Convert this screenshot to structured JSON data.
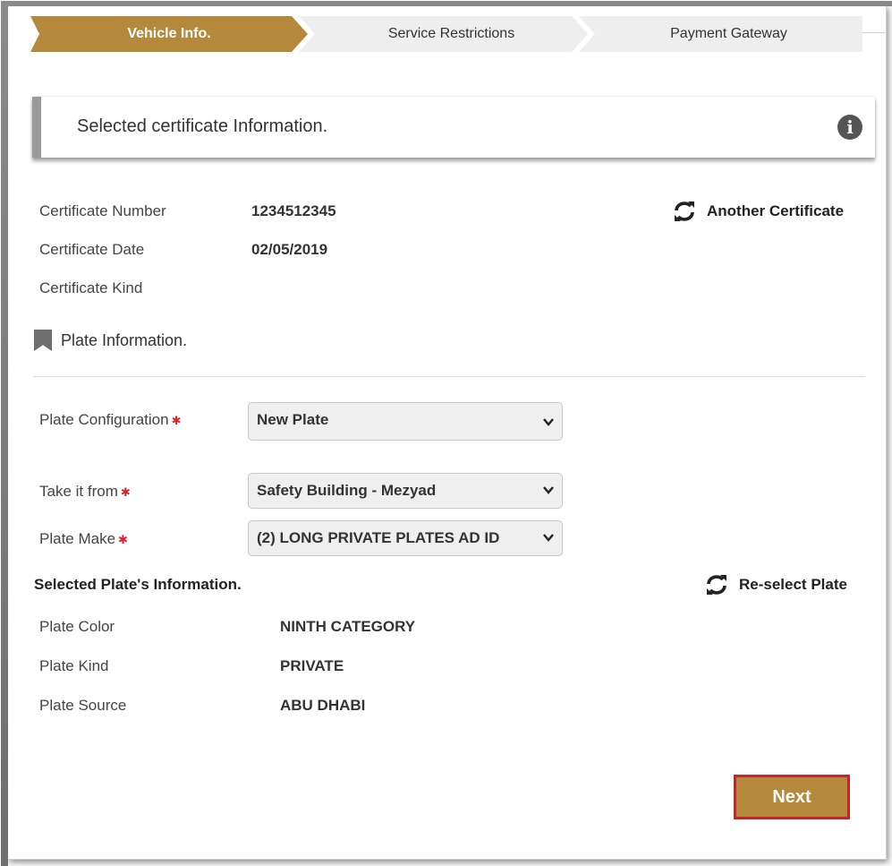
{
  "steps": [
    {
      "label": "Vehicle Info."
    },
    {
      "label": "Service Restrictions"
    },
    {
      "label": "Payment Gateway"
    }
  ],
  "info_banner": {
    "text": "Selected certificate Information.",
    "icon": "info-icon"
  },
  "certificate": {
    "number_label": "Certificate Number",
    "number_value": "1234512345",
    "date_label": "Certificate Date",
    "date_value": "02/05/2019",
    "kind_label": "Certificate Kind",
    "kind_value": "",
    "another_label": "Another Certificate"
  },
  "plate_section": {
    "title": "Plate Information.",
    "icon": "bookmark-icon"
  },
  "form": {
    "configuration_label": "Plate Configuration",
    "configuration_value": "New Plate",
    "take_from_label": "Take it from",
    "take_from_value": "Safety Building - Mezyad",
    "make_label": "Plate Make",
    "make_value": "(2) LONG PRIVATE PLATES AD ID",
    "required_mark": "✱"
  },
  "selected_plate": {
    "title": "Selected Plate's Information.",
    "reselect_label": "Re-select Plate",
    "color_label": "Plate Color",
    "color_value": "NINTH CATEGORY",
    "kind_label": "Plate Kind",
    "kind_value": "PRIVATE",
    "source_label": "Plate Source",
    "source_value": "ABU DHABI"
  },
  "actions": {
    "next_label": "Next"
  },
  "colors": {
    "accent": "#b5893c",
    "step_inactive": "#eeeeee",
    "required": "#d9232d",
    "next_border": "#c0272d"
  }
}
